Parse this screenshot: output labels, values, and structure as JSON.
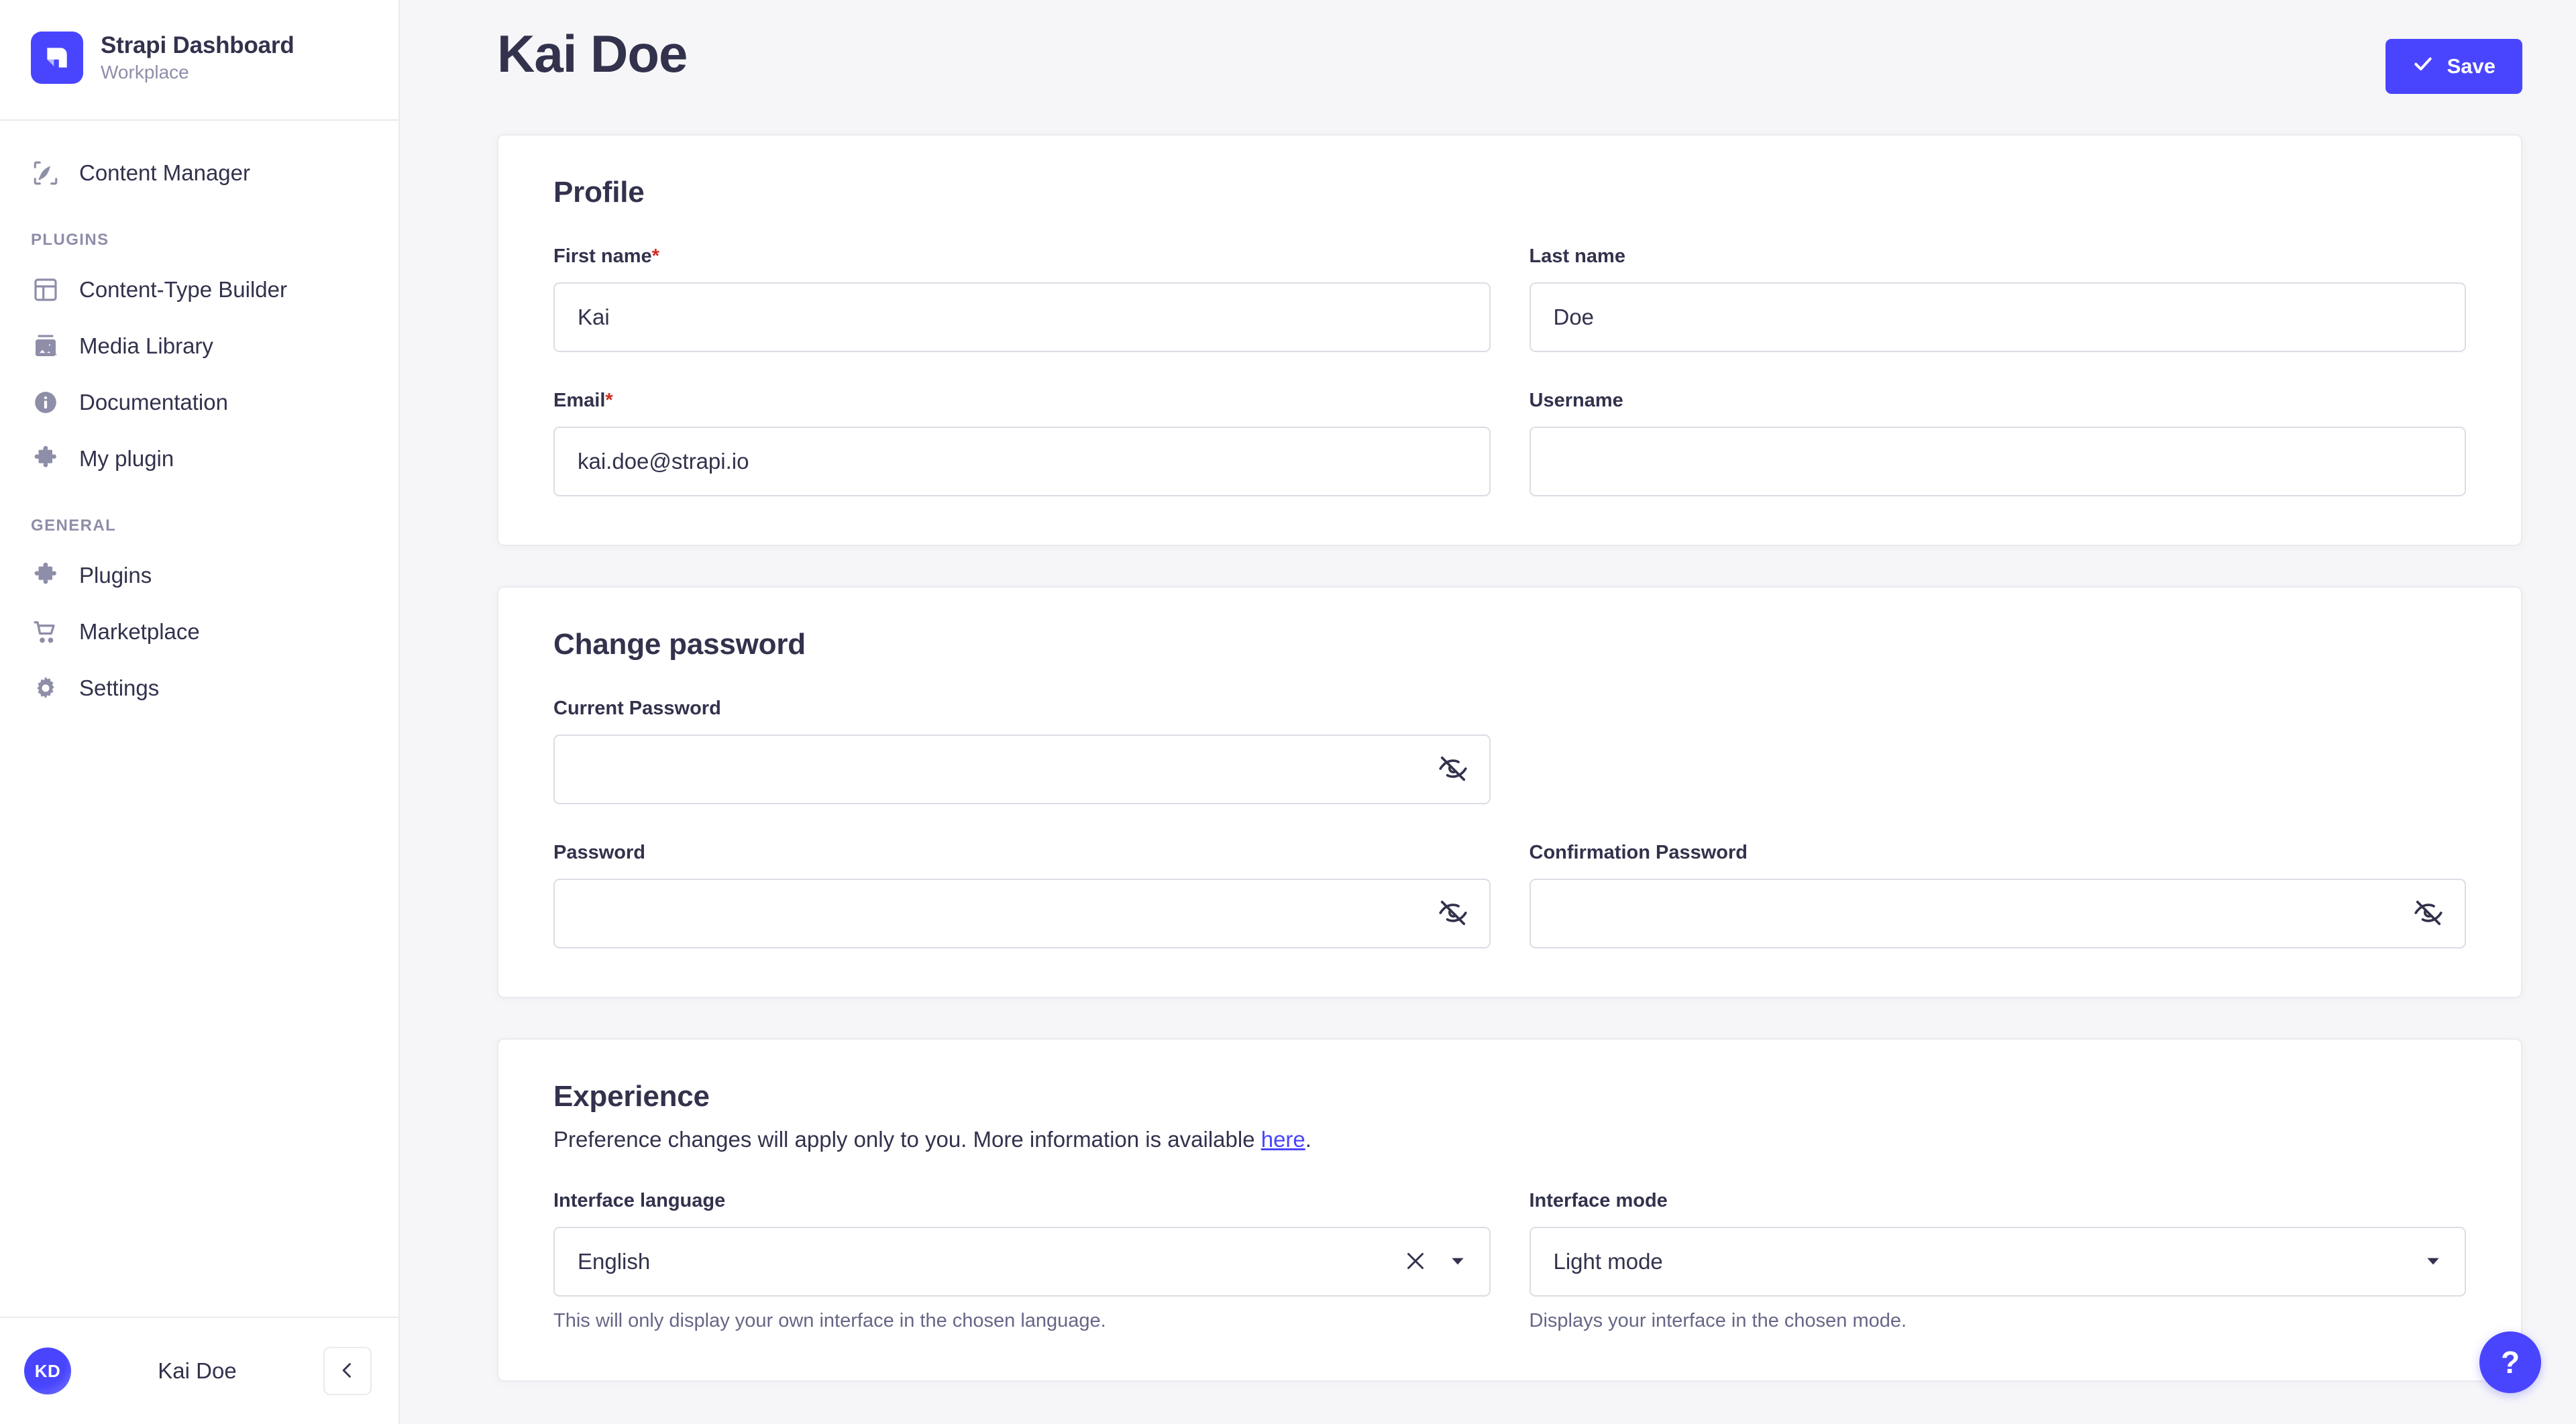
{
  "colors": {
    "accent": "#4945ff",
    "required": "#d02b20",
    "text": "#32324d",
    "muted": "#8e8ea9",
    "background": "#f6f6f9",
    "card": "#ffffff",
    "border": "#eaeaef",
    "input_border": "#dcdce4"
  },
  "sidebar": {
    "brand": {
      "title": "Strapi Dashboard",
      "subtitle": "Workplace",
      "logo_icon": "strapi-logo-icon"
    },
    "top_items": [
      {
        "label": "Content Manager",
        "icon": "feather-write-icon"
      }
    ],
    "sections": [
      {
        "title": "PLUGINS",
        "items": [
          {
            "label": "Content-Type Builder",
            "icon": "layout-blocks-icon"
          },
          {
            "label": "Media Library",
            "icon": "image-icon"
          },
          {
            "label": "Documentation",
            "icon": "info-circle-icon"
          },
          {
            "label": "My plugin",
            "icon": "puzzle-piece-icon"
          }
        ]
      },
      {
        "title": "GENERAL",
        "items": [
          {
            "label": "Plugins",
            "icon": "puzzle-piece-icon"
          },
          {
            "label": "Marketplace",
            "icon": "shopping-cart-icon"
          },
          {
            "label": "Settings",
            "icon": "gear-icon"
          }
        ]
      }
    ],
    "footer": {
      "avatar_initials": "KD",
      "user_name": "Kai Doe",
      "collapse_icon": "chevron-left-icon"
    }
  },
  "header": {
    "title": "Kai Doe",
    "save_label": "Save",
    "save_icon": "check-icon"
  },
  "profile": {
    "title": "Profile",
    "fields": {
      "first_name": {
        "label": "First name",
        "required": true,
        "value": "Kai",
        "placeholder": ""
      },
      "last_name": {
        "label": "Last name",
        "required": false,
        "value": "Doe",
        "placeholder": ""
      },
      "email": {
        "label": "Email",
        "required": true,
        "value": "kai.doe@strapi.io",
        "placeholder": ""
      },
      "username": {
        "label": "Username",
        "required": false,
        "value": "",
        "placeholder": ""
      }
    }
  },
  "change_password": {
    "title": "Change password",
    "fields": {
      "current_password": {
        "label": "Current Password",
        "value": "",
        "placeholder": "",
        "toggle_icon": "eye-off-icon"
      },
      "password": {
        "label": "Password",
        "value": "",
        "placeholder": "",
        "toggle_icon": "eye-off-icon"
      },
      "confirmation_password": {
        "label": "Confirmation Password",
        "value": "",
        "placeholder": "",
        "toggle_icon": "eye-off-icon"
      }
    }
  },
  "experience": {
    "title": "Experience",
    "description_before": "Preference changes will apply only to you. More information is available ",
    "description_link": "here",
    "description_after": ".",
    "interface_language": {
      "label": "Interface language",
      "value": "English",
      "hint": "This will only display your own interface in the chosen language.",
      "clear_icon": "close-icon",
      "caret_icon": "chevron-down-icon"
    },
    "interface_mode": {
      "label": "Interface mode",
      "value": "Light mode",
      "hint": "Displays your interface in the chosen mode.",
      "caret_icon": "chevron-down-icon"
    }
  },
  "help": {
    "label": "?",
    "icon": "question-mark-icon"
  }
}
